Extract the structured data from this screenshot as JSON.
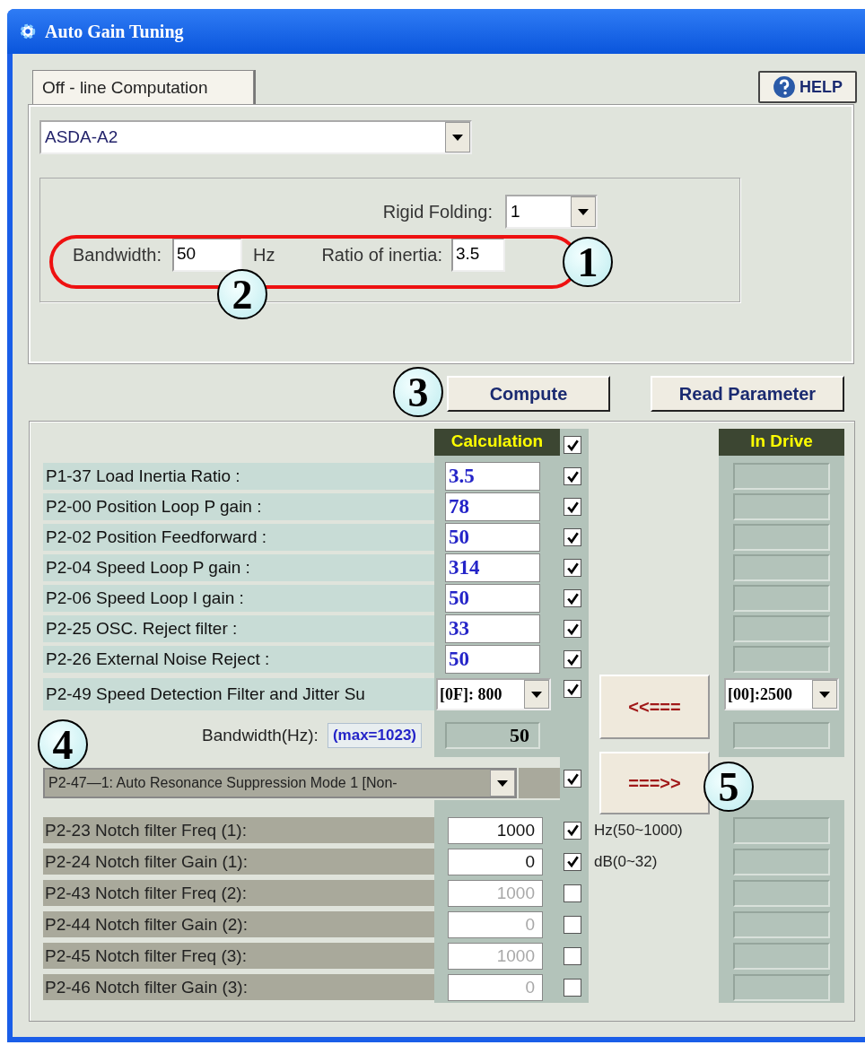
{
  "window": {
    "title": "Auto Gain Tuning"
  },
  "tabs": [
    {
      "label": "Off - line Computation",
      "selected": true
    }
  ],
  "help_button": {
    "label": "HELP"
  },
  "model_select": {
    "value": "ASDA-A2"
  },
  "rigid_folding": {
    "label": "Rigid Folding:",
    "value": "1"
  },
  "bandwidth": {
    "label": "Bandwidth:",
    "value": "50",
    "unit": "Hz"
  },
  "ratio_of_inertia": {
    "label": "Ratio of inertia:",
    "value": "3.5"
  },
  "compute_button": "Compute",
  "read_parameter_button": "Read Parameter",
  "results_header": {
    "label": "Calculation",
    "checked": true
  },
  "in_drive_header": "In Drive",
  "params": [
    {
      "label": "P1-37 Load Inertia Ratio :",
      "value": "3.5",
      "checked": true
    },
    {
      "label": "P2-00 Position Loop P gain :",
      "value": "78",
      "checked": true
    },
    {
      "label": "P2-02 Position Feedforward :",
      "value": "50",
      "checked": true
    },
    {
      "label": "P2-04 Speed Loop P gain :",
      "value": "314",
      "checked": true
    },
    {
      "label": "P2-06 Speed Loop I gain :",
      "value": "50",
      "checked": true
    },
    {
      "label": "P2-25 OSC. Reject filter :",
      "value": "33",
      "checked": true
    },
    {
      "label": "P2-26 External Noise Reject :",
      "value": "50",
      "checked": true
    }
  ],
  "p2_49": {
    "label": "P2-49 Speed Detection Filter and Jitter Su",
    "value": "[0F]: 800",
    "checked": true,
    "in_drive_value": "[00]:2500"
  },
  "bandwidth_hz": {
    "label": "Bandwidth(Hz):",
    "hint": "(max=1023)",
    "value": "50"
  },
  "read_back_button": "<<===",
  "write_button": "===>>",
  "resonance_mode": {
    "value": "P2-47—1: Auto Resonance Suppression Mode 1 [Non-",
    "checked": true
  },
  "notch": [
    {
      "label": "P2-23 Notch filter Freq (1):",
      "value": "1000",
      "checked": true,
      "unit": "Hz(50~1000)"
    },
    {
      "label": "P2-24 Notch filter Gain (1):",
      "value": "0",
      "checked": true,
      "unit": "dB(0~32)"
    },
    {
      "label": "P2-43 Notch filter Freq (2):",
      "value": "1000",
      "checked": false
    },
    {
      "label": "P2-44 Notch filter Gain (2):",
      "value": "0",
      "checked": false
    },
    {
      "label": "P2-45 Notch filter Freq (3):",
      "value": "1000",
      "checked": false
    },
    {
      "label": "P2-46 Notch filter Gain (3):",
      "value": "0",
      "checked": false
    }
  ],
  "callouts": [
    {
      "label": "1"
    },
    {
      "label": "2"
    },
    {
      "label": "3"
    },
    {
      "label": "4"
    },
    {
      "label": "5"
    }
  ]
}
